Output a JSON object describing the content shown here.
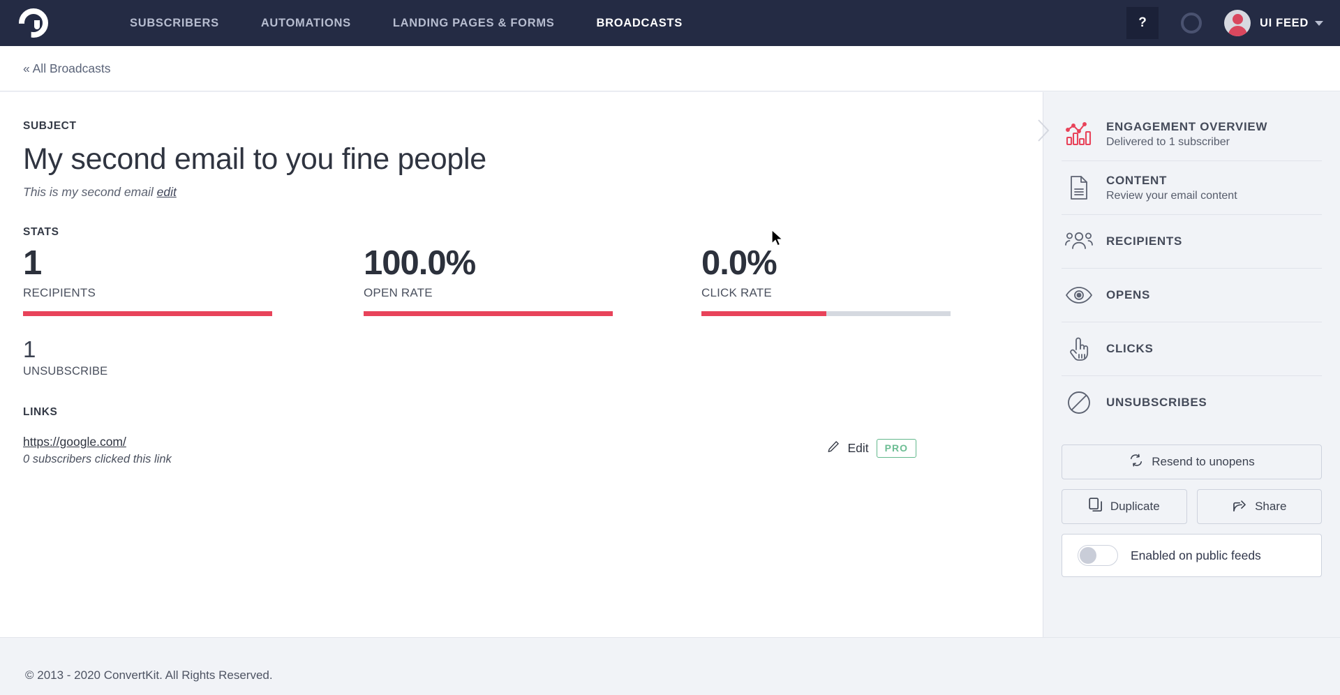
{
  "nav": {
    "logo_name": "convertkit-logo",
    "links": [
      {
        "label": "SUBSCRIBERS",
        "active": false
      },
      {
        "label": "AUTOMATIONS",
        "active": false
      },
      {
        "label": "LANDING PAGES & FORMS",
        "active": false
      },
      {
        "label": "BROADCASTS",
        "active": true
      }
    ],
    "help_label": "?",
    "user_name": "UI FEED"
  },
  "breadcrumb": {
    "label": "« All Broadcasts"
  },
  "main": {
    "subject_label": "SUBJECT",
    "subject_title": "My second email to you fine people",
    "preview_text": "This is my second email",
    "preview_edit": "edit",
    "stats_label": "STATS",
    "stats": [
      {
        "value": "1",
        "name": "RECIPIENTS",
        "bar_percent": 100
      },
      {
        "value": "100.0%",
        "name": "OPEN RATE",
        "bar_percent": 100
      },
      {
        "value": "0.0%",
        "name": "CLICK RATE",
        "bar_percent": 50
      }
    ],
    "unsubscribe_value": "1",
    "unsubscribe_label": "UNSUBSCRIBE",
    "links_label": "LINKS",
    "links": [
      {
        "url": "https://google.com/",
        "detail": "0 subscribers clicked this link",
        "edit_label": "Edit",
        "pro_label": "PRO"
      }
    ]
  },
  "sidebar": {
    "items": [
      {
        "title": "ENGAGEMENT OVERVIEW",
        "subtitle": "Delivered to 1 subscriber",
        "icon": "bar-chart-icon",
        "active": true
      },
      {
        "title": "CONTENT",
        "subtitle": "Review your email content",
        "icon": "document-icon",
        "active": false
      },
      {
        "title": "RECIPIENTS",
        "subtitle": "",
        "icon": "people-icon",
        "active": false
      },
      {
        "title": "OPENS",
        "subtitle": "",
        "icon": "eye-icon",
        "active": false
      },
      {
        "title": "CLICKS",
        "subtitle": "",
        "icon": "pointing-hand-icon",
        "active": false
      },
      {
        "title": "UNSUBSCRIBES",
        "subtitle": "",
        "icon": "no-entry-icon",
        "active": false
      }
    ],
    "resend_label": "Resend to unopens",
    "duplicate_label": "Duplicate",
    "share_label": "Share",
    "public_feeds_label": "Enabled on public feeds",
    "public_feeds_enabled": false
  },
  "footer": {
    "text": "© 2013 - 2020 ConvertKit. All Rights Reserved."
  },
  "colors": {
    "nav_bg": "#242b44",
    "accent_red": "#e8435a",
    "sidebar_bg": "#f1f3f7",
    "pro_green": "#6cbd93"
  }
}
